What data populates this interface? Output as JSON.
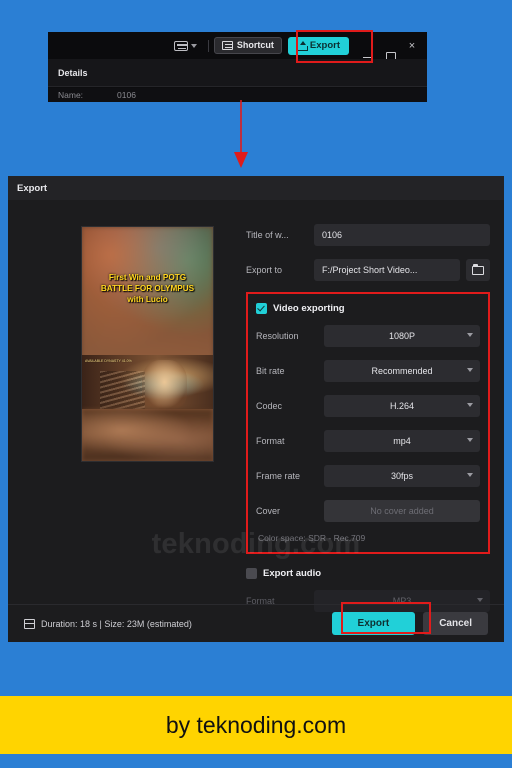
{
  "colors": {
    "page_background": "#2b7fd4",
    "accent_teal": "#21d0d8",
    "highlight_red": "#e01b1b",
    "banner_yellow": "#ffd400",
    "dialog_background": "#1c1c1e"
  },
  "top_window": {
    "toolbar": {
      "keyboard_icon": "keyboard-icon",
      "keyboard_dropdown_icon": "chevron-down-icon",
      "shortcut_label": "Shortcut",
      "shortcut_icon": "shortcut-icon",
      "export_label": "Export",
      "export_icon": "upload-icon"
    },
    "window_controls": {
      "minimize": "minimize-icon",
      "maximize": "restore-icon",
      "close": "×"
    },
    "details_label": "Details",
    "details_row": {
      "key": "Name:",
      "value": "0106"
    }
  },
  "annotation": {
    "arrow": "down-arrow",
    "arrow_color": "#e01b1b"
  },
  "dialog": {
    "title": "Export",
    "thumbnail": {
      "title_lines": [
        "First Win and POTG",
        "BATTLE FOR OLYMPUS",
        "with Lucio"
      ],
      "hud_text": "AVAILABLE\nDYNASTY\n41.0%"
    },
    "fields": {
      "title_label": "Title of w...",
      "title_value": "0106",
      "export_to_label": "Export to",
      "export_to_value": "F:/Project Short Video...",
      "folder_icon": "folder-icon"
    },
    "video_section": {
      "heading": "Video exporting",
      "checked": true,
      "rows": [
        {
          "label": "Resolution",
          "value": "1080P",
          "type": "select"
        },
        {
          "label": "Bit rate",
          "value": "Recommended",
          "type": "select"
        },
        {
          "label": "Codec",
          "value": "H.264",
          "type": "select"
        },
        {
          "label": "Format",
          "value": "mp4",
          "type": "select"
        },
        {
          "label": "Frame rate",
          "value": "30fps",
          "type": "select"
        },
        {
          "label": "Cover",
          "value": "No cover added",
          "type": "disabled"
        }
      ],
      "color_space": "Color space: SDR - Rec.709"
    },
    "audio_section": {
      "heading": "Export audio",
      "checked": false,
      "format_label": "Format",
      "format_value": "MP3"
    },
    "watermark": "teknoding.com",
    "footer": {
      "duration_icon": "film-icon",
      "duration_text": "Duration: 18 s | Size: 23M (estimated)",
      "export_label": "Export",
      "cancel_label": "Cancel"
    }
  },
  "banner": {
    "text": "by teknoding.com"
  }
}
